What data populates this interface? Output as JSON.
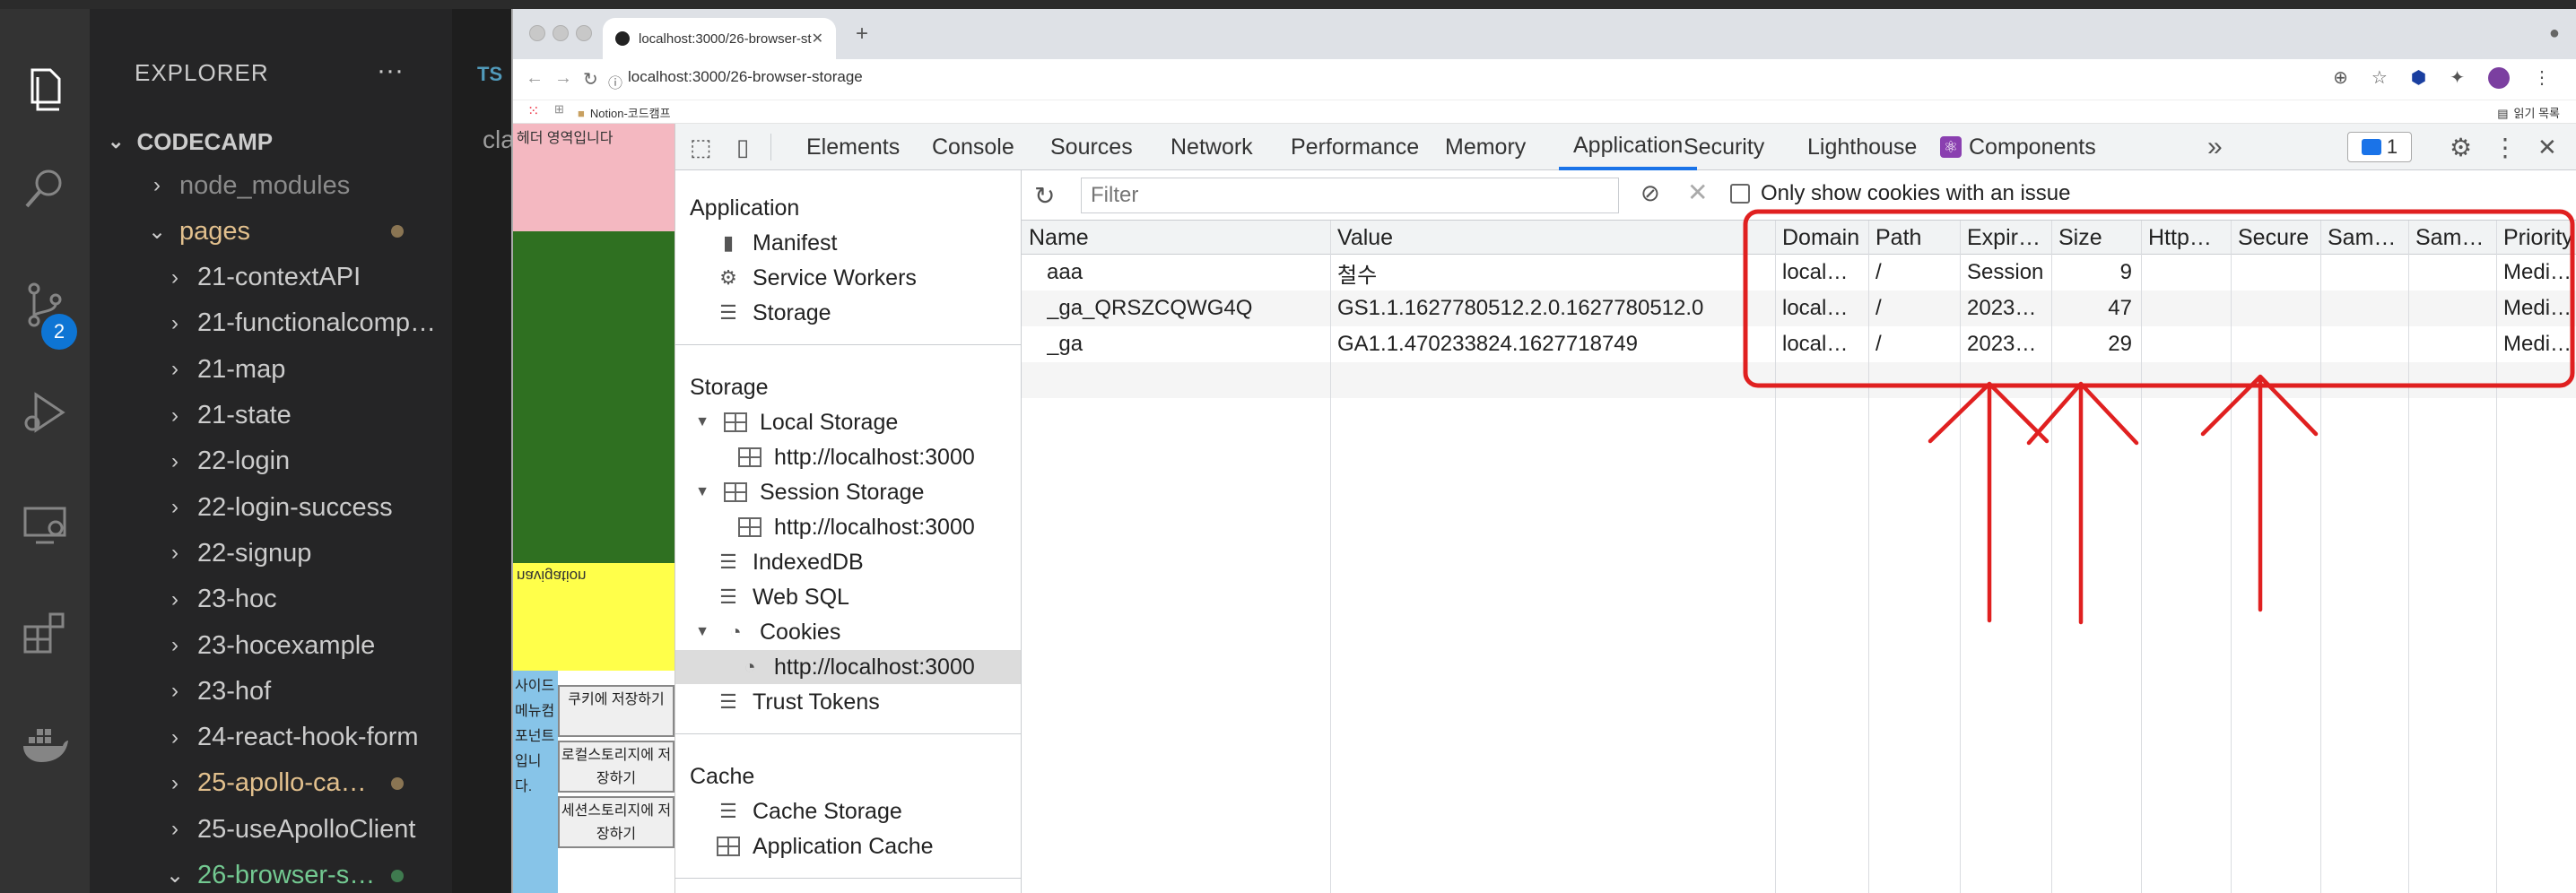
{
  "vscode": {
    "explorer_title": "EXPLORER",
    "more": "···",
    "root_folder": "CODECAMP",
    "scm_badge": "2",
    "editor_tab_label": "TS",
    "editor_text": "cla",
    "tree": [
      {
        "label": "node_modules",
        "chevron": "›",
        "color": "#8b8b8b"
      },
      {
        "label": "pages",
        "chevron": "⌄",
        "color": "#e2c08d",
        "dot": "#8a7553"
      },
      {
        "label": "21-contextAPI",
        "chevron": "›",
        "color": "#cccccc"
      },
      {
        "label": "21-functionalcomp…",
        "chevron": "›",
        "color": "#cccccc"
      },
      {
        "label": "21-map",
        "chevron": "›",
        "color": "#cccccc"
      },
      {
        "label": "21-state",
        "chevron": "›",
        "color": "#cccccc"
      },
      {
        "label": "22-login",
        "chevron": "›",
        "color": "#cccccc"
      },
      {
        "label": "22-login-success",
        "chevron": "›",
        "color": "#cccccc"
      },
      {
        "label": "22-signup",
        "chevron": "›",
        "color": "#cccccc"
      },
      {
        "label": "23-hoc",
        "chevron": "›",
        "color": "#cccccc"
      },
      {
        "label": "23-hocexample",
        "chevron": "›",
        "color": "#cccccc"
      },
      {
        "label": "23-hof",
        "chevron": "›",
        "color": "#cccccc"
      },
      {
        "label": "24-react-hook-form",
        "chevron": "›",
        "color": "#cccccc"
      },
      {
        "label": "25-apollo-ca…",
        "chevron": "›",
        "color": "#e2c08d",
        "dot": "#8a7553"
      },
      {
        "label": "25-useApolloClient",
        "chevron": "›",
        "color": "#cccccc"
      },
      {
        "label": "26-browser-s…",
        "chevron": "⌄",
        "color": "#73c991",
        "dot": "#3f7a4f"
      }
    ]
  },
  "chrome": {
    "tab_title": "localhost:3000/26-browser-st",
    "tab_close": "✕",
    "new_tab": "+",
    "url": "localhost:3000/26-browser-storage",
    "bookmark_notion": "Notion-코드캠프",
    "bookmark_reading": "읽기 목록"
  },
  "page": {
    "header_text": "헤더 영역입니다",
    "nav_text": "navigation",
    "side_text": "사이드메뉴컴포넌트입니다.",
    "buttons": [
      "쿠키에 저장하기",
      "로컬스토리지에 저장하기",
      "세션스토리지에 저장하기"
    ]
  },
  "devtools": {
    "tabs": [
      "Elements",
      "Console",
      "Sources",
      "Network",
      "Performance",
      "Memory",
      "Application",
      "Security",
      "Lighthouse",
      "Components"
    ],
    "active_tab": "Application",
    "more_tabs": "»",
    "issues_count": "1",
    "close": "✕",
    "sidebar": {
      "application_title": "Application",
      "application_items": [
        "Manifest",
        "Service Workers",
        "Storage"
      ],
      "storage_title": "Storage",
      "local_storage": "Local Storage",
      "local_storage_origin": "http://localhost:3000",
      "session_storage": "Session Storage",
      "session_storage_origin": "http://localhost:3000",
      "indexeddb": "IndexedDB",
      "websql": "Web SQL",
      "cookies": "Cookies",
      "cookies_origin": "http://localhost:3000",
      "trust_tokens": "Trust Tokens",
      "cache_title": "Cache",
      "cache_storage": "Cache Storage",
      "app_cache": "Application Cache"
    },
    "cookies": {
      "filter_placeholder": "Filter",
      "only_issues_label": "Only show cookies with an issue",
      "columns": [
        "Name",
        "Value",
        "Domain",
        "Path",
        "Expir…",
        "Size",
        "Http…",
        "Secure",
        "Sam…",
        "Sam…",
        "Priority"
      ],
      "rows": [
        [
          "aaa",
          "철수",
          "local…",
          "/",
          "Session",
          "9",
          "",
          "",
          "",
          "",
          "Medi…"
        ],
        [
          "_ga_QRSZCQWG4Q",
          "GS1.1.1627780512.2.0.1627780512.0",
          "local…",
          "/",
          "2023…",
          "47",
          "",
          "",
          "",
          "",
          "Medi…"
        ],
        [
          "_ga",
          "GA1.1.470233824.1627718749",
          "local…",
          "/",
          "2023…",
          "29",
          "",
          "",
          "",
          "",
          "Medi…"
        ]
      ]
    }
  },
  "colors": {
    "annotation": "#e02020",
    "accent": "#1a73e8"
  }
}
